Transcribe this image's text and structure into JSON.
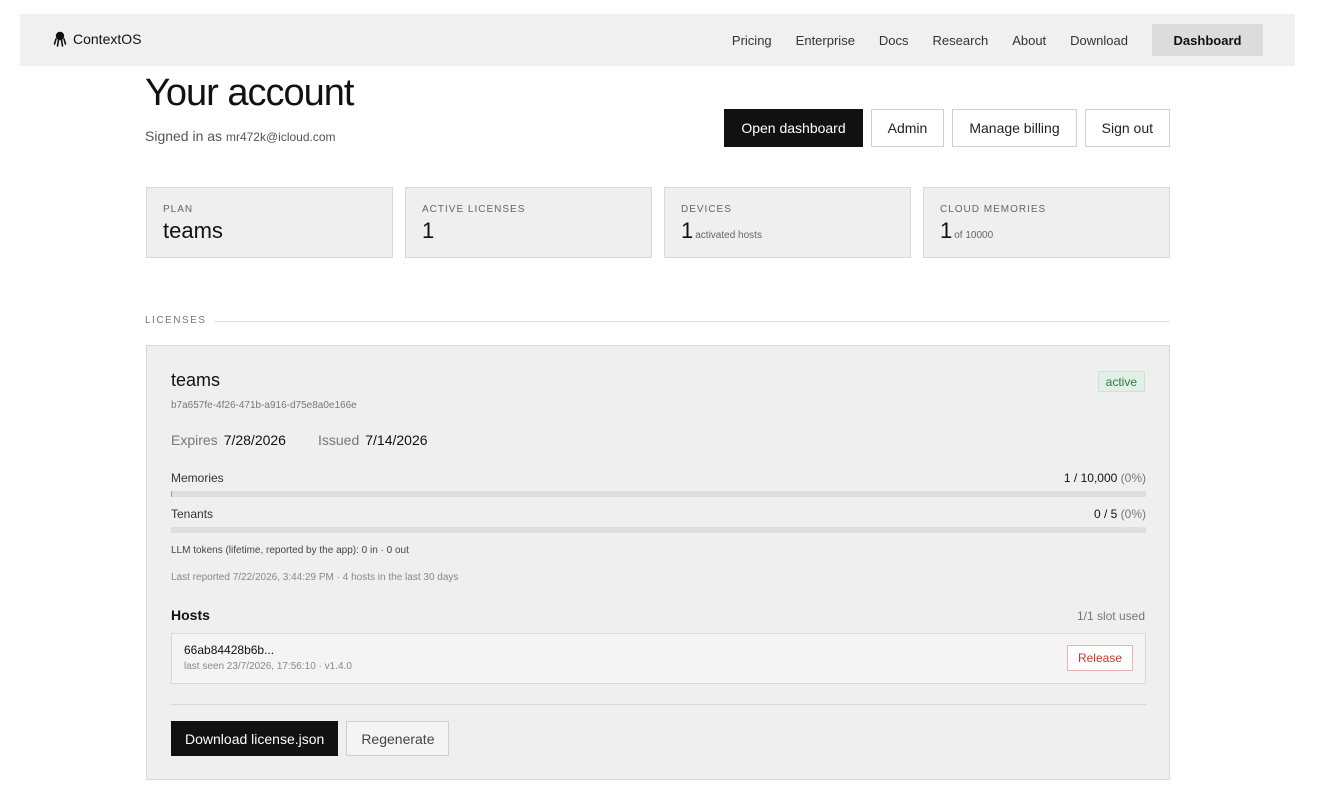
{
  "nav": {
    "brand": "ContextOS",
    "brand_icon": "octopus-icon",
    "links": [
      "Pricing",
      "Enterprise",
      "Docs",
      "Research",
      "About",
      "Download"
    ],
    "dashboard_label": "Dashboard"
  },
  "header": {
    "title": "Your account",
    "signed_in_prefix": "Signed in as",
    "email": "mr472k@icloud.com",
    "actions": {
      "open_dashboard": "Open dashboard",
      "admin": "Admin",
      "manage_billing": "Manage billing",
      "sign_out": "Sign out"
    }
  },
  "stats": [
    {
      "label": "PLAN",
      "value": "teams",
      "sub": ""
    },
    {
      "label": "ACTIVE LICENSES",
      "value": "1",
      "sub": ""
    },
    {
      "label": "DEVICES",
      "value": "1",
      "sub": "activated hosts"
    },
    {
      "label": "CLOUD MEMORIES",
      "value": "1",
      "sub": "of 10000"
    }
  ],
  "licenses": {
    "section_label": "LICENSES",
    "items": [
      {
        "name": "teams",
        "id": "b7a657fe-4f26-471b-a916-d75e8a0e166e",
        "status": "active",
        "expires_label": "Expires",
        "expires": "7/28/2026",
        "issued_label": "Issued",
        "issued": "7/14/2026",
        "memories": {
          "label": "Memories",
          "value": "1 / 10,000",
          "pct": "(0%)",
          "fraction": 0.0001
        },
        "tenants": {
          "label": "Tenants",
          "value": "0 / 5",
          "pct": "(0%)",
          "fraction": 0
        },
        "llm_tokens": "LLM tokens (lifetime, reported by the app): 0 in · 0 out",
        "last_reported": "Last reported 7/22/2026, 3:44:29 PM · 4 hosts in the last 30 days",
        "hosts_title": "Hosts",
        "slots": "1/1 slot used",
        "hosts": [
          {
            "id": "66ab84428b6b...",
            "seen": "last seen 23/7/2026, 17:56:10 · v1.4.0",
            "release_label": "Release"
          }
        ],
        "download_label": "Download license.json",
        "regenerate_label": "Regenerate"
      }
    ]
  }
}
